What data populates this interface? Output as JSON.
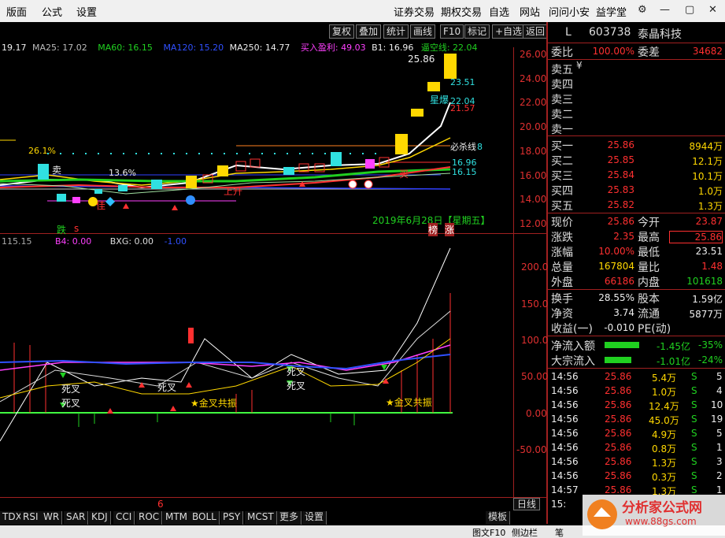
{
  "menu": [
    "版面",
    "公式",
    "设置"
  ],
  "nav": [
    "证券交易",
    "期权交易",
    "自选",
    "网站",
    "问问小安",
    "益学堂"
  ],
  "toolbar": [
    "复权",
    "叠加",
    "统计",
    "画线",
    "F10",
    "标记",
    "+自选",
    "返回"
  ],
  "indicators": {
    "ma_partial": "19.17",
    "ma25": "MA25: 17.02",
    "ma60": "MA60: 16.15",
    "ma120": "MA120: 15.20",
    "ma250": "MA250: 14.77",
    "buy_profit": "买入盈利: 49.03",
    "b1": "B1: 16.96",
    "shortline": "逼空线: 22.04"
  },
  "main_ylabels": [
    "26.00",
    "24.00",
    "22.00",
    "20.00",
    "18.00",
    "16.00",
    "14.00",
    "12.00"
  ],
  "main_annotations": {
    "high": "25.86",
    "l2351": "23.51",
    "l2204": "22.04",
    "l2157": "21.57",
    "bisha": "必杀线",
    "l18": "8",
    "l1696": "16.96",
    "l1615": "16.15",
    "pct1": "26.1%",
    "pct2": "13.6%",
    "sell": "卖",
    "star": "星爆",
    "up": "上升",
    "buy": "买",
    "jia": "佳",
    "date": "2019年6月28日【星期五】",
    "die": "跌",
    "rank": "榜",
    "zhang": "涨",
    "s": "s"
  },
  "sub_indicators": {
    "v": "115.15",
    "b4": "B4: 0.00",
    "bxg": "BXG: 0.00",
    "m1": "-1.00"
  },
  "sub_ylabels": [
    "200.0",
    "150.0",
    "100.0",
    "50.00",
    "0.00",
    "-50.00"
  ],
  "sub_annotations": {
    "sicha": "死叉",
    "jincha": "金叉共振",
    "six": "6"
  },
  "stock": {
    "tag": "L",
    "code": "603738",
    "name": "泰晶科技"
  },
  "weibi": {
    "label1": "委比",
    "value1": "100.00%",
    "label2": "委差",
    "value2": "34682"
  },
  "sell_levels": [
    "卖五",
    "卖四",
    "卖三",
    "卖二",
    "卖一"
  ],
  "sell_yen": "¥",
  "buy_levels": [
    {
      "label": "买一",
      "price": "25.86",
      "vol": "8944万"
    },
    {
      "label": "买二",
      "price": "25.85",
      "vol": "12.1万"
    },
    {
      "label": "买三",
      "price": "25.84",
      "vol": "10.1万"
    },
    {
      "label": "买四",
      "price": "25.83",
      "vol": "1.0万"
    },
    {
      "label": "买五",
      "price": "25.82",
      "vol": "1.3万"
    }
  ],
  "quote": [
    {
      "l1": "现价",
      "v1": "25.86",
      "l2": "今开",
      "v2": "23.87"
    },
    {
      "l1": "涨跌",
      "v1": "2.35",
      "l2": "最高",
      "v2": "25.86"
    },
    {
      "l1": "涨幅",
      "v1": "10.00%",
      "l2": "最低",
      "v2": "23.51"
    },
    {
      "l1": "总量",
      "v1": "167804",
      "l2": "量比",
      "v2": "1.48"
    },
    {
      "l1": "外盘",
      "v1": "66186",
      "l2": "内盘",
      "v2": "101618"
    }
  ],
  "finance": [
    {
      "l1": "换手",
      "v1": "28.55%",
      "l2": "股本",
      "v2": "1.59亿"
    },
    {
      "l1": "净资",
      "v1": "3.74",
      "l2": "流通",
      "v2": "5877万"
    },
    {
      "l1": "收益(一)",
      "v1": "-0.010",
      "l2": "PE(动)",
      "v2": ""
    }
  ],
  "flows": [
    {
      "label": "净流入额",
      "value": "-1.45亿",
      "pct": "-35%"
    },
    {
      "label": "大宗流入",
      "value": "-1.01亿",
      "pct": "-24%"
    }
  ],
  "ticks": [
    {
      "t": "14:56",
      "p": "25.86",
      "v": "5.4万",
      "s": "S",
      "n": "5"
    },
    {
      "t": "14:56",
      "p": "25.86",
      "v": "1.0万",
      "s": "S",
      "n": "4"
    },
    {
      "t": "14:56",
      "p": "25.86",
      "v": "12.4万",
      "s": "S",
      "n": "10"
    },
    {
      "t": "14:56",
      "p": "25.86",
      "v": "45.0万",
      "s": "S",
      "n": "19"
    },
    {
      "t": "14:56",
      "p": "25.86",
      "v": "4.9万",
      "s": "S",
      "n": "5"
    },
    {
      "t": "14:56",
      "p": "25.86",
      "v": "0.8万",
      "s": "S",
      "n": "1"
    },
    {
      "t": "14:56",
      "p": "25.86",
      "v": "1.3万",
      "s": "S",
      "n": "3"
    },
    {
      "t": "14:56",
      "p": "25.86",
      "v": "0.3万",
      "s": "S",
      "n": "2"
    },
    {
      "t": "14:57",
      "p": "25.86",
      "v": "1.3万",
      "s": "S",
      "n": "1"
    }
  ],
  "tick_partial": "15:",
  "day_label": "日线",
  "bottom_tabs": [
    "TDX",
    "RSI",
    "WR",
    "SAR",
    "KDJ",
    "CCI",
    "ROC",
    "MTM",
    "BOLL",
    "PSY",
    "MCST",
    "更多",
    "设置"
  ],
  "template_label": "模板",
  "status": {
    "left": "图文F10",
    "mid": "侧边栏",
    "right": "笔"
  },
  "watermark": {
    "site": "分析家公式网",
    "url": "www.88gs.com"
  },
  "colors": {
    "up": "#ff3030",
    "down": "#20d020",
    "ma_white": "#ffffff",
    "ma_yellow": "#ffd800",
    "ma_green": "#20d020",
    "ma_blue": "#3040ff",
    "accent": "#a02020"
  }
}
